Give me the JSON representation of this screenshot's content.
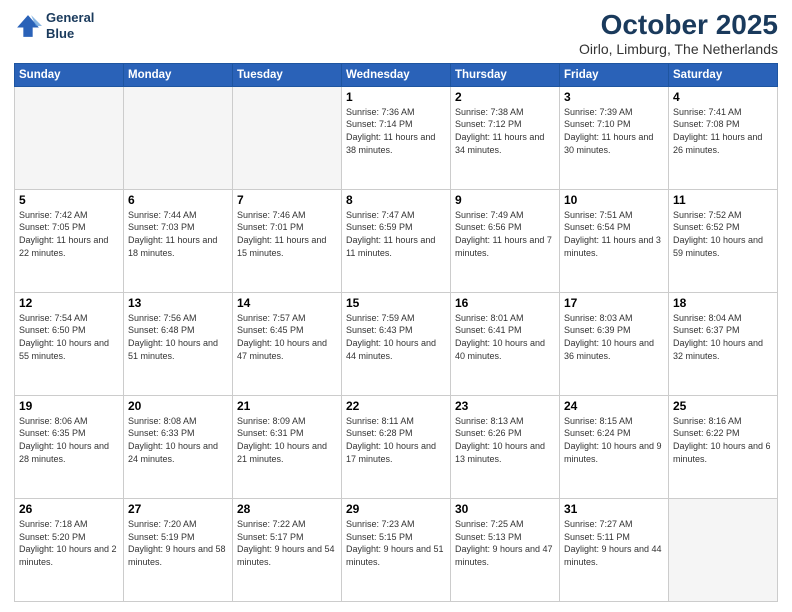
{
  "header": {
    "logo_line1": "General",
    "logo_line2": "Blue",
    "month": "October 2025",
    "location": "Oirlo, Limburg, The Netherlands"
  },
  "weekdays": [
    "Sunday",
    "Monday",
    "Tuesday",
    "Wednesday",
    "Thursday",
    "Friday",
    "Saturday"
  ],
  "weeks": [
    [
      {
        "day": "",
        "info": ""
      },
      {
        "day": "",
        "info": ""
      },
      {
        "day": "",
        "info": ""
      },
      {
        "day": "1",
        "info": "Sunrise: 7:36 AM\nSunset: 7:14 PM\nDaylight: 11 hours\nand 38 minutes."
      },
      {
        "day": "2",
        "info": "Sunrise: 7:38 AM\nSunset: 7:12 PM\nDaylight: 11 hours\nand 34 minutes."
      },
      {
        "day": "3",
        "info": "Sunrise: 7:39 AM\nSunset: 7:10 PM\nDaylight: 11 hours\nand 30 minutes."
      },
      {
        "day": "4",
        "info": "Sunrise: 7:41 AM\nSunset: 7:08 PM\nDaylight: 11 hours\nand 26 minutes."
      }
    ],
    [
      {
        "day": "5",
        "info": "Sunrise: 7:42 AM\nSunset: 7:05 PM\nDaylight: 11 hours\nand 22 minutes."
      },
      {
        "day": "6",
        "info": "Sunrise: 7:44 AM\nSunset: 7:03 PM\nDaylight: 11 hours\nand 18 minutes."
      },
      {
        "day": "7",
        "info": "Sunrise: 7:46 AM\nSunset: 7:01 PM\nDaylight: 11 hours\nand 15 minutes."
      },
      {
        "day": "8",
        "info": "Sunrise: 7:47 AM\nSunset: 6:59 PM\nDaylight: 11 hours\nand 11 minutes."
      },
      {
        "day": "9",
        "info": "Sunrise: 7:49 AM\nSunset: 6:56 PM\nDaylight: 11 hours\nand 7 minutes."
      },
      {
        "day": "10",
        "info": "Sunrise: 7:51 AM\nSunset: 6:54 PM\nDaylight: 11 hours\nand 3 minutes."
      },
      {
        "day": "11",
        "info": "Sunrise: 7:52 AM\nSunset: 6:52 PM\nDaylight: 10 hours\nand 59 minutes."
      }
    ],
    [
      {
        "day": "12",
        "info": "Sunrise: 7:54 AM\nSunset: 6:50 PM\nDaylight: 10 hours\nand 55 minutes."
      },
      {
        "day": "13",
        "info": "Sunrise: 7:56 AM\nSunset: 6:48 PM\nDaylight: 10 hours\nand 51 minutes."
      },
      {
        "day": "14",
        "info": "Sunrise: 7:57 AM\nSunset: 6:45 PM\nDaylight: 10 hours\nand 47 minutes."
      },
      {
        "day": "15",
        "info": "Sunrise: 7:59 AM\nSunset: 6:43 PM\nDaylight: 10 hours\nand 44 minutes."
      },
      {
        "day": "16",
        "info": "Sunrise: 8:01 AM\nSunset: 6:41 PM\nDaylight: 10 hours\nand 40 minutes."
      },
      {
        "day": "17",
        "info": "Sunrise: 8:03 AM\nSunset: 6:39 PM\nDaylight: 10 hours\nand 36 minutes."
      },
      {
        "day": "18",
        "info": "Sunrise: 8:04 AM\nSunset: 6:37 PM\nDaylight: 10 hours\nand 32 minutes."
      }
    ],
    [
      {
        "day": "19",
        "info": "Sunrise: 8:06 AM\nSunset: 6:35 PM\nDaylight: 10 hours\nand 28 minutes."
      },
      {
        "day": "20",
        "info": "Sunrise: 8:08 AM\nSunset: 6:33 PM\nDaylight: 10 hours\nand 24 minutes."
      },
      {
        "day": "21",
        "info": "Sunrise: 8:09 AM\nSunset: 6:31 PM\nDaylight: 10 hours\nand 21 minutes."
      },
      {
        "day": "22",
        "info": "Sunrise: 8:11 AM\nSunset: 6:28 PM\nDaylight: 10 hours\nand 17 minutes."
      },
      {
        "day": "23",
        "info": "Sunrise: 8:13 AM\nSunset: 6:26 PM\nDaylight: 10 hours\nand 13 minutes."
      },
      {
        "day": "24",
        "info": "Sunrise: 8:15 AM\nSunset: 6:24 PM\nDaylight: 10 hours\nand 9 minutes."
      },
      {
        "day": "25",
        "info": "Sunrise: 8:16 AM\nSunset: 6:22 PM\nDaylight: 10 hours\nand 6 minutes."
      }
    ],
    [
      {
        "day": "26",
        "info": "Sunrise: 7:18 AM\nSunset: 5:20 PM\nDaylight: 10 hours\nand 2 minutes."
      },
      {
        "day": "27",
        "info": "Sunrise: 7:20 AM\nSunset: 5:19 PM\nDaylight: 9 hours\nand 58 minutes."
      },
      {
        "day": "28",
        "info": "Sunrise: 7:22 AM\nSunset: 5:17 PM\nDaylight: 9 hours\nand 54 minutes."
      },
      {
        "day": "29",
        "info": "Sunrise: 7:23 AM\nSunset: 5:15 PM\nDaylight: 9 hours\nand 51 minutes."
      },
      {
        "day": "30",
        "info": "Sunrise: 7:25 AM\nSunset: 5:13 PM\nDaylight: 9 hours\nand 47 minutes."
      },
      {
        "day": "31",
        "info": "Sunrise: 7:27 AM\nSunset: 5:11 PM\nDaylight: 9 hours\nand 44 minutes."
      },
      {
        "day": "",
        "info": ""
      }
    ]
  ]
}
